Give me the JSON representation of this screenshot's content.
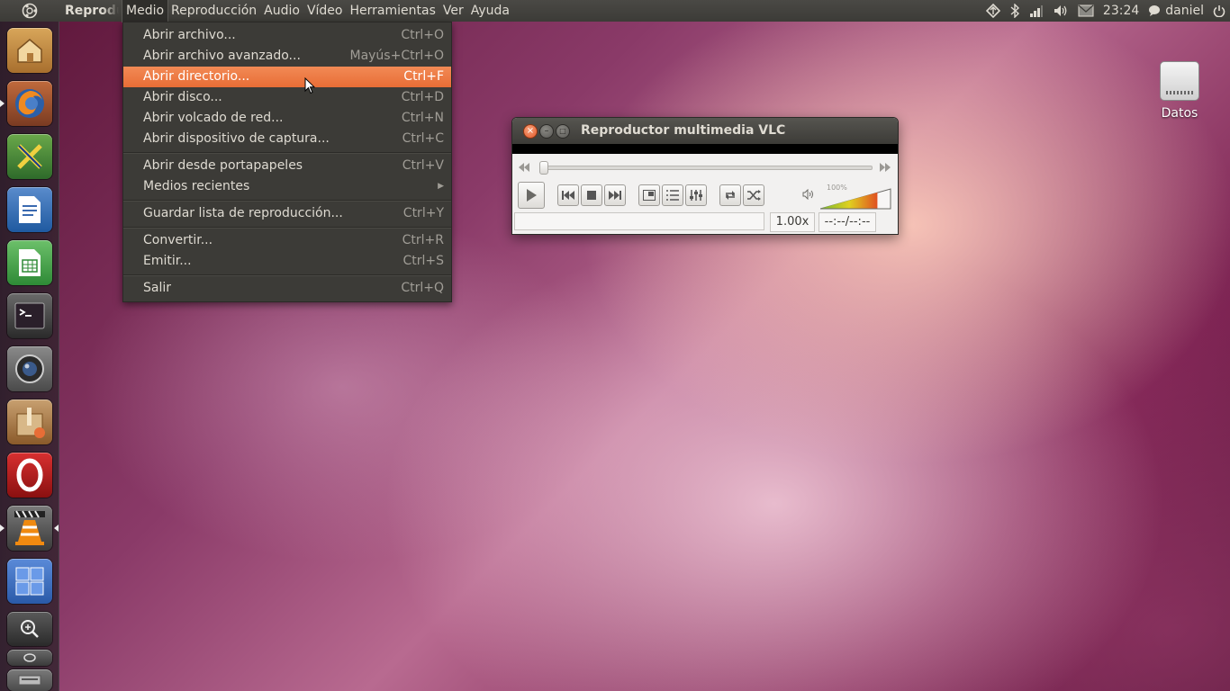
{
  "top_panel": {
    "app_title": "Reproductor multimedia VLC",
    "menus": [
      "Medio",
      "Reproducción",
      "Audio",
      "Vídeo",
      "Herramientas",
      "Ver",
      "Ayuda"
    ],
    "active_menu": "Medio",
    "clock": "23:24",
    "user": "daniel",
    "indicators": [
      "network-icon",
      "bluetooth-icon",
      "signal-icon",
      "volume-icon",
      "mail-icon",
      "chat-icon",
      "power-icon"
    ]
  },
  "medio_menu": {
    "items": [
      {
        "label": "Abrir archivo...",
        "accel": "Ctrl+O"
      },
      {
        "label": "Abrir archivo avanzado...",
        "accel": "Mayús+Ctrl+O"
      },
      {
        "label": "Abrir directorio...",
        "accel": "Ctrl+F"
      },
      {
        "label": "Abrir disco...",
        "accel": "Ctrl+D"
      },
      {
        "label": "Abrir volcado de red...",
        "accel": "Ctrl+N"
      },
      {
        "label": "Abrir dispositivo de captura...",
        "accel": "Ctrl+C"
      },
      {
        "label": "Abrir desde portapapeles",
        "accel": "Ctrl+V"
      },
      {
        "label": "Medios recientes",
        "accel": ""
      },
      {
        "label": "Guardar lista de reproducción...",
        "accel": "Ctrl+Y"
      },
      {
        "label": "Convertir...",
        "accel": "Ctrl+R"
      },
      {
        "label": "Emitir...",
        "accel": "Ctrl+S"
      },
      {
        "label": "Salir",
        "accel": "Ctrl+Q"
      }
    ],
    "highlighted": "Abrir directorio..."
  },
  "vlc_window": {
    "title": "Reproductor multimedia VLC",
    "volume_label": "100%",
    "volume_level": 1.0,
    "playback_rate": "1.00x",
    "time": "--:--/--:--",
    "status_text": ""
  },
  "desktop": {
    "icons": [
      {
        "label": "Datos"
      }
    ]
  },
  "launcher": {
    "apps": [
      "home-folder",
      "firefox",
      "xmind",
      "writer",
      "calc",
      "terminal",
      "cheese",
      "software-center",
      "opera",
      "vlc",
      "workspaces",
      "lens",
      "trash"
    ]
  },
  "colors": {
    "panel": "#3c3b37",
    "menu_highlight": "#e86d36",
    "panel_text": "#dfdbd2"
  }
}
